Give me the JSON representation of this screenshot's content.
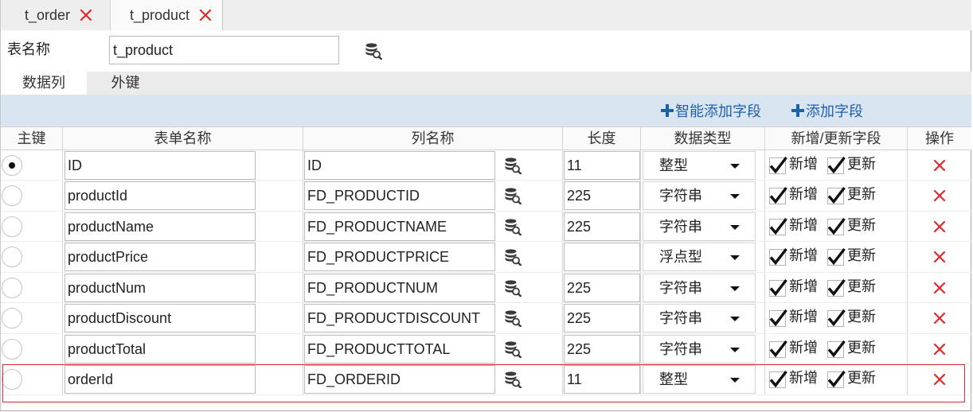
{
  "tabs": [
    {
      "label": "t_order",
      "active": false
    },
    {
      "label": "t_product",
      "active": true
    }
  ],
  "table_name": {
    "label": "表名称",
    "value": "t_product"
  },
  "subtabs": [
    {
      "label": "数据列",
      "active": true
    },
    {
      "label": "外键",
      "active": false
    }
  ],
  "toolbar": {
    "smart_add_label": "智能添加字段",
    "add_label": "添加字段"
  },
  "columns": [
    "主键",
    "表单名称",
    "列名称",
    "长度",
    "数据类型",
    "新增/更新字段",
    "操作"
  ],
  "checkbox_labels": {
    "insert": "新增",
    "update": "更新"
  },
  "rows": [
    {
      "primary": true,
      "form_name": "ID",
      "column_name": "ID",
      "length": "11",
      "data_type": "整型",
      "insert": true,
      "update": true
    },
    {
      "primary": false,
      "form_name": "productId",
      "column_name": "FD_PRODUCTID",
      "length": "225",
      "data_type": "字符串",
      "insert": true,
      "update": true
    },
    {
      "primary": false,
      "form_name": "productName",
      "column_name": "FD_PRODUCTNAME",
      "length": "225",
      "data_type": "字符串",
      "insert": true,
      "update": true
    },
    {
      "primary": false,
      "form_name": "productPrice",
      "column_name": "FD_PRODUCTPRICE",
      "length": "",
      "data_type": "浮点型",
      "insert": true,
      "update": true
    },
    {
      "primary": false,
      "form_name": "productNum",
      "column_name": "FD_PRODUCTNUM",
      "length": "225",
      "data_type": "字符串",
      "insert": true,
      "update": true
    },
    {
      "primary": false,
      "form_name": "productDiscount",
      "column_name": "FD_PRODUCTDISCOUNT",
      "length": "225",
      "data_type": "字符串",
      "insert": true,
      "update": true
    },
    {
      "primary": false,
      "form_name": "productTotal",
      "column_name": "FD_PRODUCTTOTAL",
      "length": "225",
      "data_type": "字符串",
      "insert": true,
      "update": true
    },
    {
      "primary": false,
      "form_name": "orderId",
      "column_name": "FD_ORDERID",
      "length": "11",
      "data_type": "整型",
      "insert": true,
      "update": true,
      "highlighted": true
    }
  ],
  "icons": {
    "tab_close": "close-icon",
    "lookup": "database-search-icon",
    "add": "plus-icon",
    "dropdown": "chevron-down-icon",
    "delete": "close-icon",
    "checkbox": "checkmark-icon"
  },
  "colors": {
    "accent": "#1f5fae",
    "delete": "#e02a2a",
    "highlight_border": "#d5303a",
    "toolbar_bg": "#d9e6f2"
  }
}
